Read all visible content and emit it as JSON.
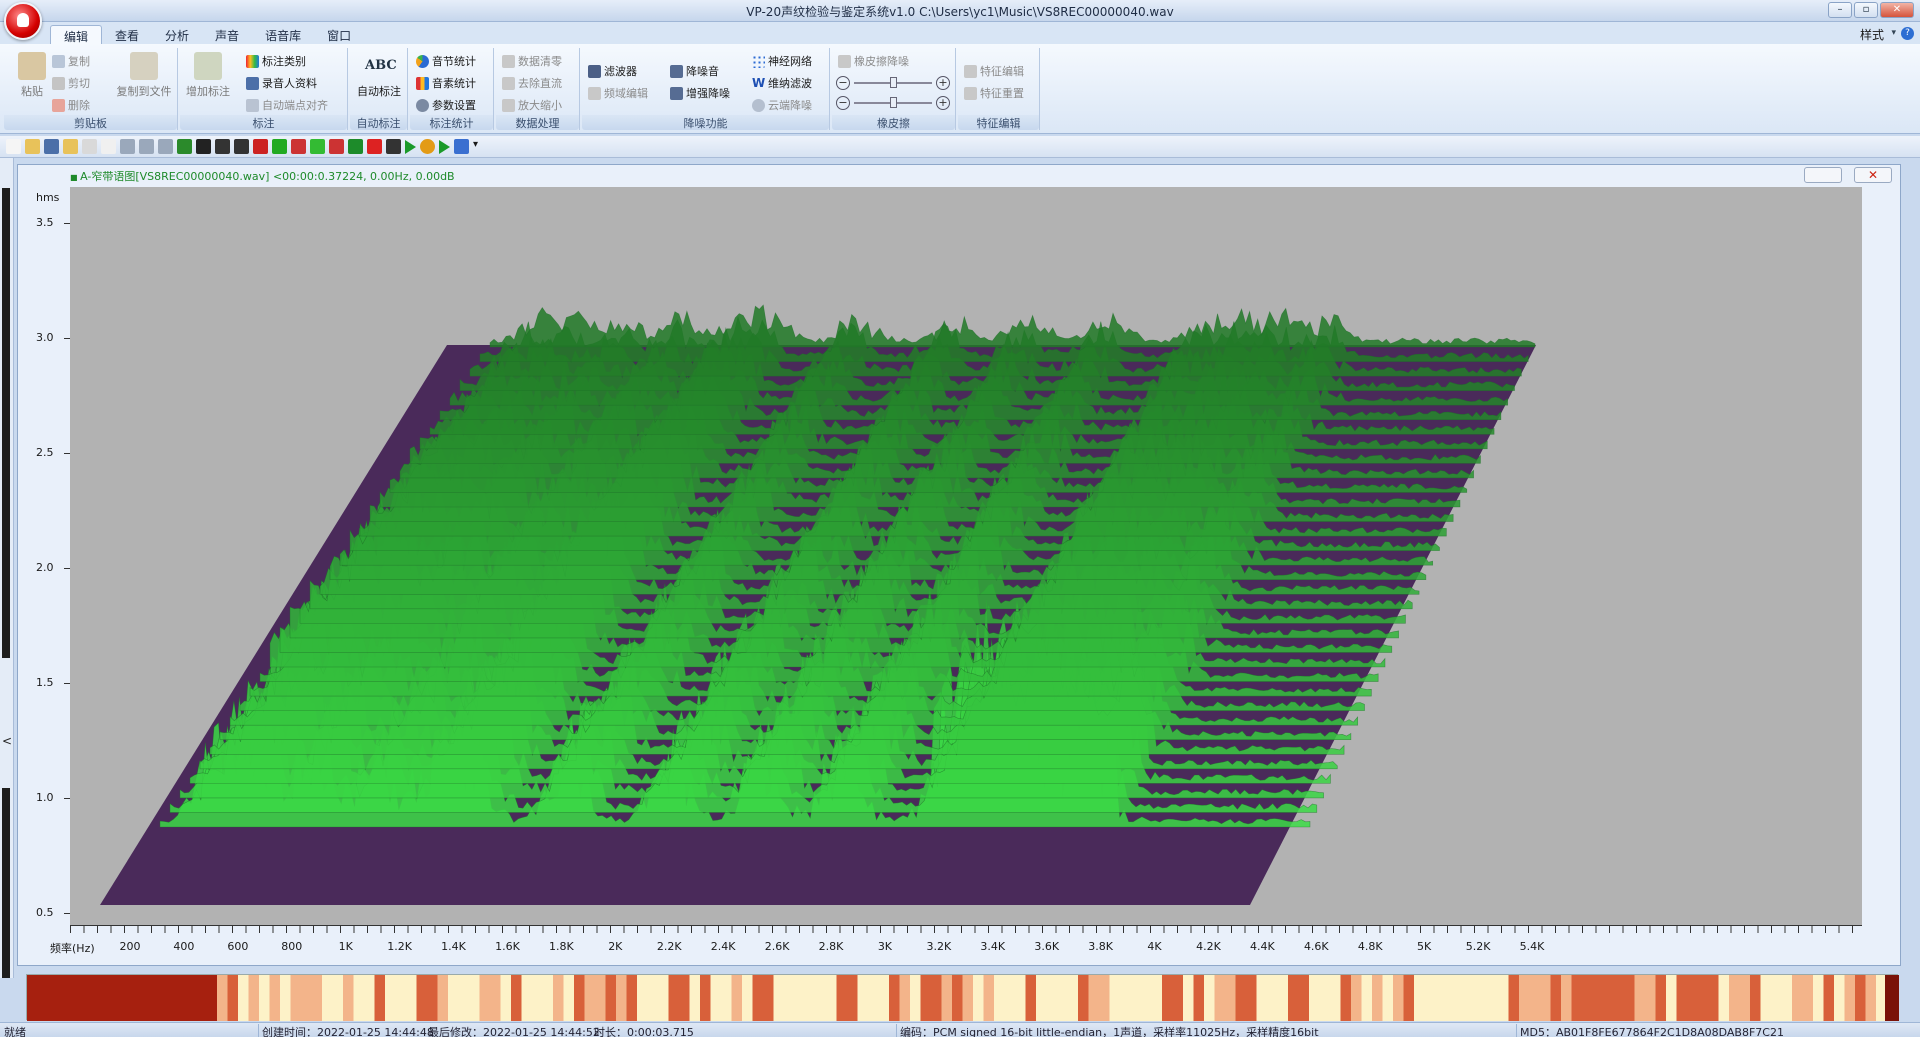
{
  "window": {
    "title": "VP-20声纹检验与鉴定系统v1.0    C:\\Users\\yc1\\Music\\VS8REC00000040.wav",
    "controls": [
      "–",
      "▫",
      "✕"
    ]
  },
  "menu": {
    "tabs": [
      "编辑",
      "查看",
      "分析",
      "声音",
      "语音库",
      "窗口"
    ],
    "active_tab": "编辑",
    "style_label": "样式",
    "help_label": "?"
  },
  "ribbon": {
    "clipboard": {
      "label": "剪贴板",
      "paste": "粘贴",
      "copy": "复制",
      "cut": "剪切",
      "delete": "删除",
      "copy_to_file": "复制到文件"
    },
    "annotation": {
      "label": "标注",
      "add": "增加标注",
      "category": "标注类别",
      "speaker_info": "录音人资料",
      "auto_align": "自动端点对齐"
    },
    "auto_annotation": {
      "label": "自动标注",
      "button": "自动标注",
      "abc": "ABC"
    },
    "stats": {
      "label": "标注统计",
      "syllable": "音节统计",
      "phoneme": "音素统计",
      "params": "参数设置"
    },
    "data_processing": {
      "label": "数据处理",
      "zero": "数据清零",
      "remove_dc": "去除直流",
      "zoom": "放大缩小"
    },
    "denoise": {
      "label": "降噪功能",
      "filter": "滤波器",
      "freq_edit": "频域编辑",
      "denoise": "降噪音",
      "enhance": "增强降噪",
      "neural": "神经网络",
      "wiener": "维纳滤波",
      "cepstrum": "云端降噪"
    },
    "eraser": {
      "label": "橡皮擦",
      "eraser_denoise": "橡皮擦降噪",
      "minus": "−",
      "plus": "+"
    },
    "feature": {
      "label": "特征编辑",
      "edit": "特征编辑",
      "reset": "特征重置"
    }
  },
  "toolbar": {
    "icons": [
      "new-icon",
      "open-icon",
      "save-icon",
      "folder-icon",
      "record-icon",
      "page-icon",
      "zoom-icon",
      "zoom-in-icon",
      "zoom-out-icon",
      "waveform-icon",
      "bars-icon",
      "spectrum-icon",
      "lines-icon",
      "formant-icon",
      "pitch-icon",
      "energy-icon",
      "harmonics-icon",
      "peaks-icon",
      "curve-icon",
      "link-icon",
      "cross-icon",
      "play-icon",
      "record-play-icon",
      "loop-icon",
      "stop-icon",
      "dropdown-icon"
    ]
  },
  "plot": {
    "title": "A-窄带语图[VS8REC00000040.wav] <00:00:0.37224, 0.00Hz, 0.00dB",
    "colors": {
      "background": "#b2b2b2",
      "floor": "#4a2a5a",
      "peak": "#44dd44"
    }
  },
  "chart_data": {
    "type": "area",
    "ylabel": "hms",
    "xlabel": "频率(Hz)",
    "y_ticks": [
      "3.5",
      "3.0",
      "2.5",
      "2.0",
      "1.5",
      "1.0",
      "0.5"
    ],
    "y_values": [
      3.5,
      3.0,
      2.5,
      2.0,
      1.5,
      1.0,
      0.5
    ],
    "x_ticks": [
      "200",
      "400",
      "600",
      "800",
      "1K",
      "1.2K",
      "1.4K",
      "1.6K",
      "1.8K",
      "2K",
      "2.2K",
      "2.4K",
      "2.6K",
      "2.8K",
      "3K",
      "3.2K",
      "3.4K",
      "3.6K",
      "3.8K",
      "4K",
      "4.2K",
      "4.4K",
      "4.6K",
      "4.8K",
      "5K",
      "5.2K",
      "5.4K"
    ],
    "x_values": [
      200,
      400,
      600,
      800,
      1000,
      1200,
      1400,
      1600,
      1800,
      2000,
      2200,
      2400,
      2600,
      2800,
      3000,
      3200,
      3400,
      3600,
      3800,
      4000,
      4200,
      4400,
      4600,
      4800,
      5000,
      5200,
      5400
    ],
    "xlim": [
      0,
      5400
    ],
    "ylim": [
      0.4,
      3.7
    ],
    "peak_frequency_hz": [
      250,
      450,
      700,
      1000,
      1300,
      1450,
      1900,
      2400,
      2800,
      3200,
      3700,
      3900,
      4100,
      4350
    ]
  },
  "status": {
    "ready": "就绪",
    "created": "创建时间：2022-01-25 14:44:48",
    "modified": "最后修改：2022-01-25 14:44:52",
    "duration": "时长：0:00:03.715",
    "encoding": "编码：PCM signed 16-bit little-endian，1声道，采样率11025Hz，采样精度16bit",
    "md5": "MD5：AB01F8FE677864F2C1D8A08DAB8F7C21"
  }
}
